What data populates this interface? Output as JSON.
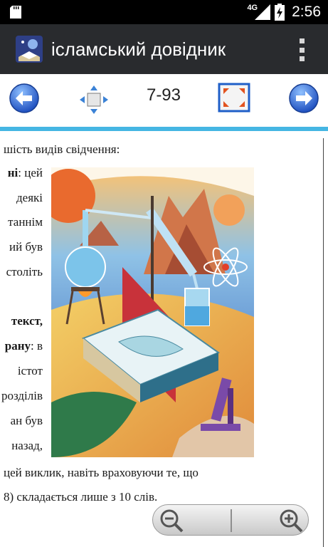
{
  "status_bar": {
    "network": "4G",
    "time": "2:56"
  },
  "action_bar": {
    "title": "ісламський довідник",
    "icons": {
      "app": "app-logo-icon",
      "menu": "overflow-menu-icon"
    }
  },
  "toolbar": {
    "page": "7-93",
    "icons": {
      "prev": "arrow-left-icon",
      "move": "move-arrows-icon",
      "fullscreen": "fullscreen-icon",
      "next": "arrow-right-icon"
    }
  },
  "content": {
    "line1": "шість видів свідчення:",
    "left_col": [
      {
        "text": "ні",
        "bold": true,
        "suffix": ": цей"
      },
      {
        "text": "деякі"
      },
      {
        "text": "таннім"
      },
      {
        "text": "ий був"
      },
      {
        "text": "століть"
      },
      {
        "text": ""
      },
      {
        "text": "текст,",
        "bold": true
      },
      {
        "text": "рану",
        "bold": true,
        "suffix": ": в"
      },
      {
        "text": "істот"
      },
      {
        "text": "розділів"
      },
      {
        "text": "ан був"
      },
      {
        "text": "назад,"
      }
    ],
    "line_bottom1": "цей виклик, навіть враховуючи те, що",
    "line_bottom2": "8) складається лише з 10 слів."
  },
  "zoom": {
    "icons": {
      "out": "zoom-out-icon",
      "in": "zoom-in-icon"
    }
  },
  "colors": {
    "accent": "#45b6e3",
    "actionbar": "#292b2e"
  }
}
